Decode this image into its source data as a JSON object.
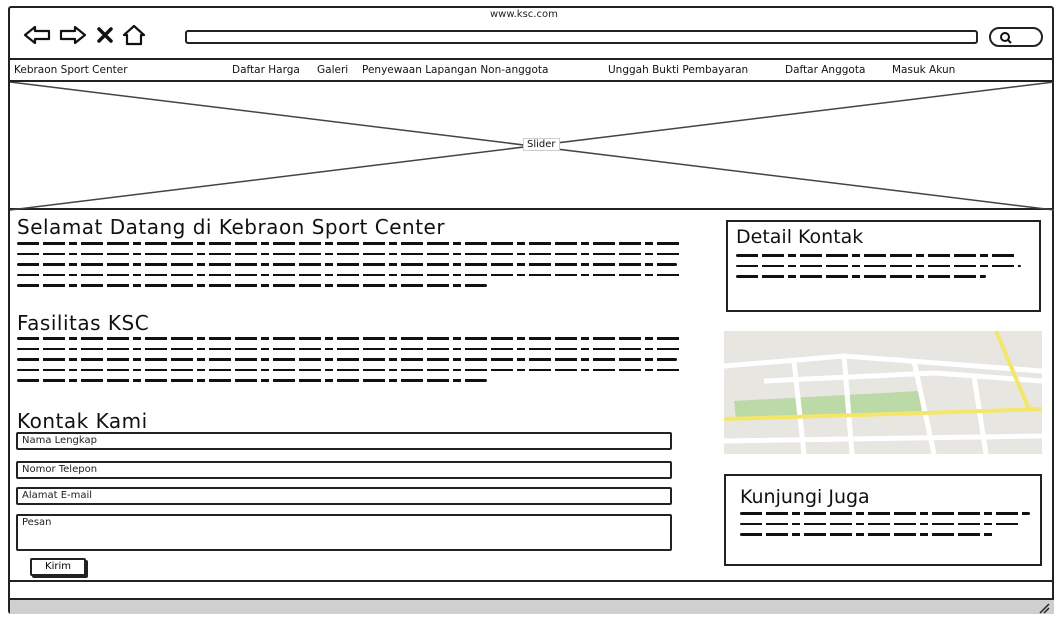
{
  "browser": {
    "url": "www.ksc.com"
  },
  "nav": {
    "brand": "Kebraon Sport Center",
    "links": [
      "Daftar Harga",
      "Galeri",
      "Penyewaan Lapangan Non-anggota",
      "Unggah Bukti Pembayaran",
      "Daftar Anggota",
      "Masuk Akun"
    ]
  },
  "slider": {
    "label": "Slider"
  },
  "main": {
    "welcome_title": "Selamat Datang di Kebraon Sport Center",
    "facilities_title": "Fasilitas KSC",
    "contact_title": "Kontak Kami"
  },
  "form": {
    "name_placeholder": "Nama Lengkap",
    "phone_placeholder": "Nomor Telepon",
    "email_placeholder": "Alamat E-mail",
    "message_placeholder": "Pesan",
    "submit_label": "Kirim"
  },
  "sidebar": {
    "contact_detail_title": "Detail Kontak",
    "visit_title": "Kunjungi Juga"
  },
  "colors": {
    "map_bg": "#e8e6e1",
    "map_road": "#ffffff",
    "map_highway": "#f3e66b",
    "map_park": "#bcd9a8",
    "footer": "#cfcfcf"
  }
}
